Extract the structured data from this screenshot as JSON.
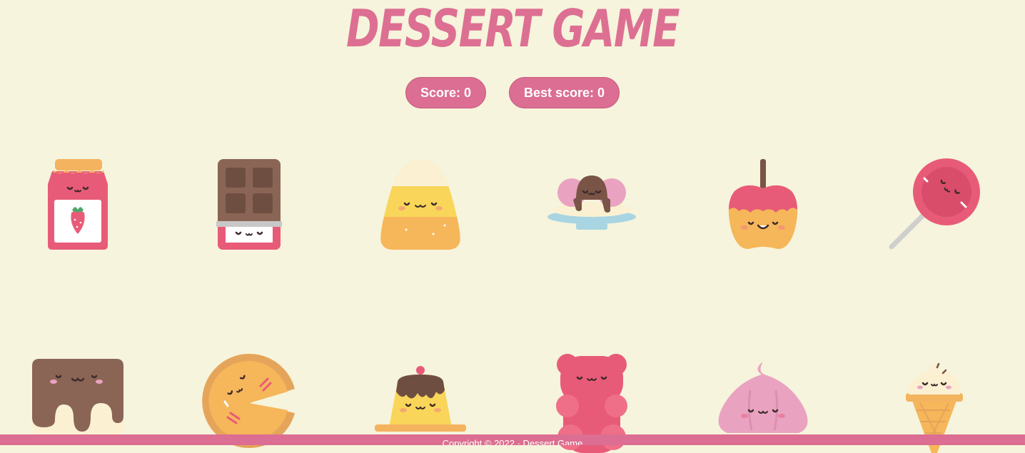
{
  "game": {
    "title": "DESSERT GAME"
  },
  "scoreboard": {
    "score_label": "Score: 0",
    "best_label": "Best score: 0"
  },
  "footer": {
    "text": "Copyright © 2022 · Dessert Game"
  },
  "colors": {
    "background": "#f6f4dc",
    "accent": "#db6e92"
  },
  "cards": [
    {
      "icon": "strawberry-jam-icon"
    },
    {
      "icon": "chocolate-bar-icon"
    },
    {
      "icon": "candy-corn-icon"
    },
    {
      "icon": "banana-split-icon"
    },
    {
      "icon": "candy-apple-icon"
    },
    {
      "icon": "lollipop-icon"
    },
    {
      "icon": "chocolate-cake-icon"
    },
    {
      "icon": "pie-icon"
    },
    {
      "icon": "pudding-icon"
    },
    {
      "icon": "gummy-bear-icon"
    },
    {
      "icon": "meringue-icon"
    },
    {
      "icon": "ice-cream-cone-icon"
    }
  ]
}
